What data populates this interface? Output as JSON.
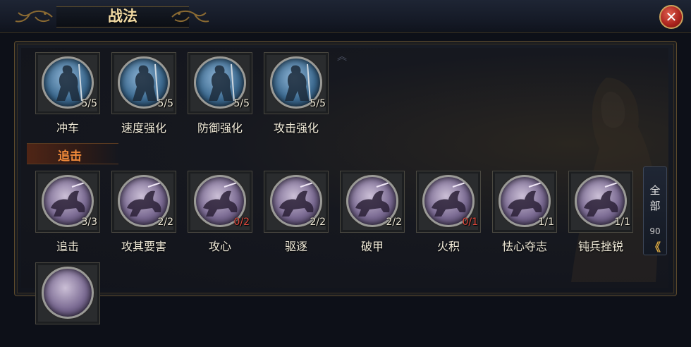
{
  "header": {
    "title": "战法",
    "close_icon": "close-icon"
  },
  "skills_row1": [
    {
      "name": "冲车",
      "level": "5/5",
      "maxed": true,
      "icon": "soldier-blue-icon"
    },
    {
      "name": "速度强化",
      "level": "5/5",
      "maxed": true,
      "icon": "soldier-blue-icon"
    },
    {
      "name": "防御强化",
      "level": "5/5",
      "maxed": true,
      "icon": "soldier-blue-icon"
    },
    {
      "name": "攻击强化",
      "level": "5/5",
      "maxed": true,
      "icon": "soldier-blue-icon"
    }
  ],
  "section": {
    "label": "追击"
  },
  "skills_row2": [
    {
      "name": "追击",
      "level": "3/3",
      "maxed": true,
      "icon": "rider-purple-icon"
    },
    {
      "name": "攻其要害",
      "level": "2/2",
      "maxed": true,
      "icon": "rider-purple-icon"
    },
    {
      "name": "攻心",
      "level": "0/2",
      "maxed": false,
      "icon": "rider-purple-icon"
    },
    {
      "name": "驱逐",
      "level": "2/2",
      "maxed": true,
      "icon": "rider-purple-icon"
    },
    {
      "name": "破甲",
      "level": "2/2",
      "maxed": true,
      "icon": "rider-purple-icon"
    },
    {
      "name": "火积",
      "level": "0/1",
      "maxed": false,
      "icon": "rider-purple-icon"
    },
    {
      "name": "怯心夺志",
      "level": "1/1",
      "maxed": true,
      "icon": "rider-purple-icon"
    },
    {
      "name": "钝兵挫锐",
      "level": "1/1",
      "maxed": true,
      "icon": "rider-purple-icon"
    }
  ],
  "filter": {
    "label": "全部",
    "count": "90",
    "arrow": "《"
  },
  "colors": {
    "level_normal": "#ece6d4",
    "level_zero": "#e0493d",
    "section_text": "#f08a3a",
    "title_text": "#f1d9a2"
  }
}
